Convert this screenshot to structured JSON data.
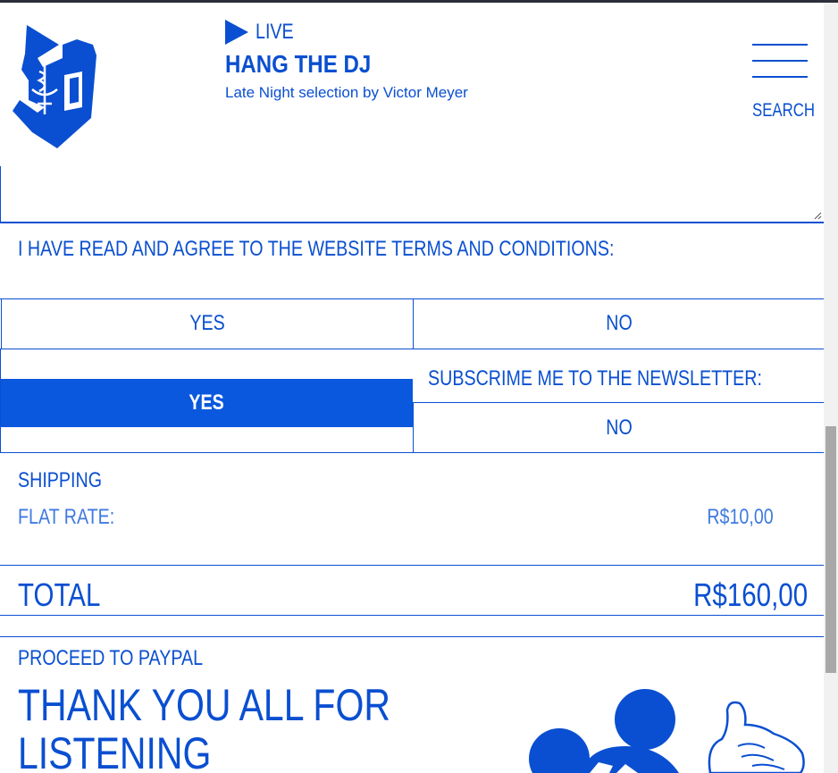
{
  "header": {
    "live_label": "LIVE",
    "show_title": "HANG THE DJ",
    "show_subtitle": "Late Night selection by Victor Meyer",
    "search_label": "SEARCH"
  },
  "form": {
    "message_value": "",
    "terms_question": "I HAVE READ AND AGREE TO THE WEBSITE TERMS AND CONDITIONS:",
    "terms_yes": "YES",
    "terms_no": "NO",
    "newsletter_question": "SUBSCRIME ME TO THE NEWSLETTER:",
    "newsletter_yes": "YES",
    "newsletter_no": "NO",
    "newsletter_selected": "YES"
  },
  "shipping": {
    "title": "SHIPPING",
    "method_label": "FLAT RATE:",
    "method_value": "R$10,00"
  },
  "total": {
    "label": "TOTAL",
    "value": "R$160,00"
  },
  "footer": {
    "paypal_label": "PROCEED TO PAYPAL",
    "thanks_text": "THANK YOU ALL FOR LISTENING"
  },
  "colors": {
    "brand_blue": "#0a4fd1",
    "selected_blue": "#0a58dd",
    "muted_blue": "#3f7ae0"
  },
  "icons": {
    "logo": "pharmacy-logo-icon",
    "live": "play-icon",
    "menu": "hamburger-menu-icon",
    "decoration": "cartoon-hand-icon"
  }
}
